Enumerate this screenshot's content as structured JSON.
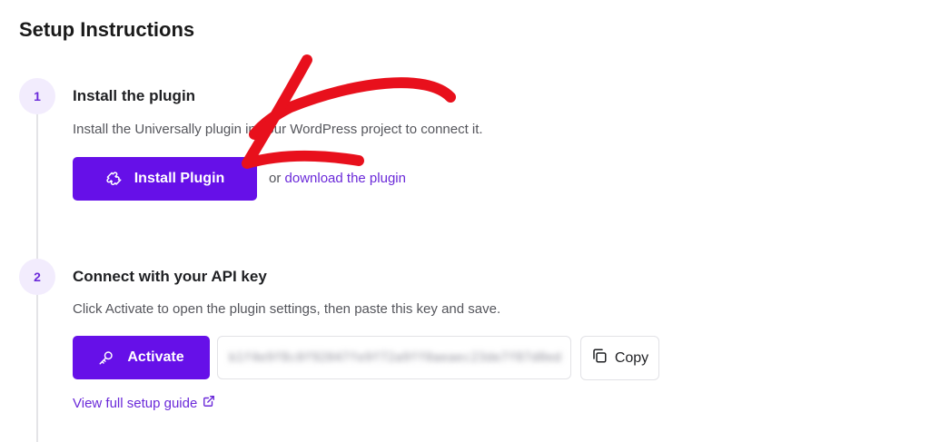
{
  "page": {
    "title": "Setup Instructions"
  },
  "steps": [
    {
      "number": "1",
      "title": "Install the plugin",
      "description": "Install the Universally plugin in your WordPress project to connect it.",
      "button_label": "Install Plugin",
      "or_text": "or",
      "link_text": "download the plugin"
    },
    {
      "number": "2",
      "title": "Connect with your API key",
      "description": "Click Activate to open the plugin settings, then paste this key and save.",
      "button_label": "Activate",
      "api_key": "b1f4e9f8c0f92047fe9f72a9ff0aeaec23de7f87d0ed",
      "copy_label": "Copy",
      "guide_link": "View full setup guide"
    }
  ],
  "icons": {
    "install_button": "puzzle-icon",
    "activate_button": "key-icon",
    "copy_button": "copy-icon",
    "guide_link": "external-link-icon"
  },
  "colors": {
    "accent": "#6610e8",
    "link": "#6b2ad9",
    "step_badge_bg": "#f2ecfd",
    "annotation": "#e8101c"
  }
}
